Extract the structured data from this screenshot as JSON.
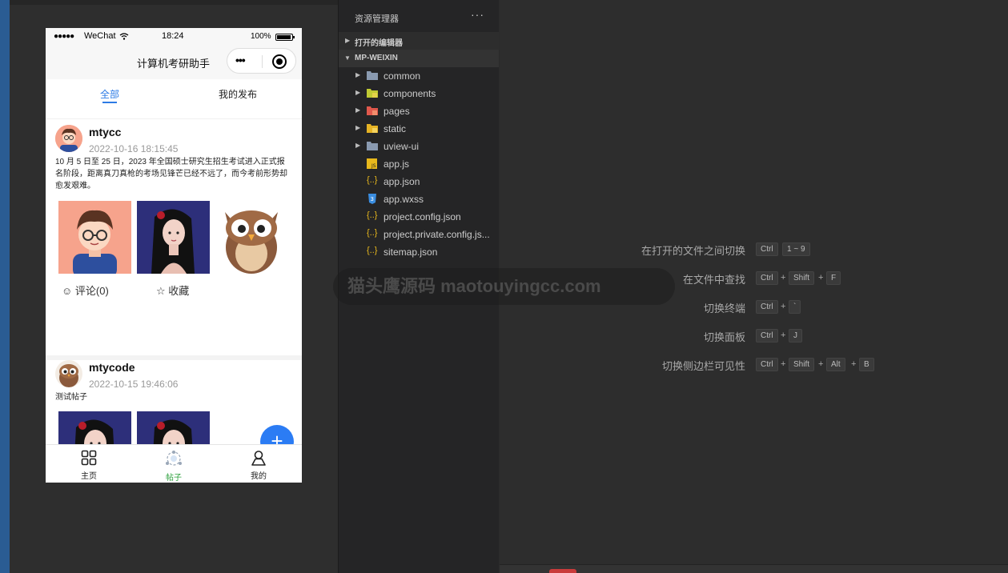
{
  "status_bar": {
    "signal": "●●●●●",
    "carrier": "WeChat",
    "time": "18:24",
    "battery": "100%"
  },
  "navbar": {
    "title": "计算机考研助手",
    "more": "•••"
  },
  "tabs": [
    {
      "label": "全部"
    },
    {
      "label": "我的发布"
    }
  ],
  "posts": [
    {
      "user": "mtycc",
      "date": "2022-10-16 18:15:45",
      "text": "10 月 5 日至 25 日，2023 年全国硕士研究生招生考试进入正式报名阶段，距离真刀真枪的考场见锋芒已经不远了，而今考前形势却愈发艰难。",
      "comments": "评论(0)",
      "favorite": "收藏"
    },
    {
      "user": "mtycode",
      "date": "2022-10-15 19:46:06",
      "text": "测试帖子"
    }
  ],
  "fab": "+",
  "tabbar": [
    {
      "label": "主页"
    },
    {
      "label": "帖子"
    },
    {
      "label": "我的"
    }
  ],
  "explorer": {
    "title": "资源管理器",
    "more": "···",
    "open_editors": "打开的编辑器",
    "root": "MP-WEIXIN",
    "items": [
      {
        "name": "common",
        "icon": "folder-icon"
      },
      {
        "name": "components",
        "icon": "folder-icon"
      },
      {
        "name": "pages",
        "icon": "folder-icon"
      },
      {
        "name": "static",
        "icon": "folder-icon"
      },
      {
        "name": "uview-ui",
        "icon": "folder-icon"
      },
      {
        "name": "app.js",
        "icon": "js-file-icon"
      },
      {
        "name": "app.json",
        "icon": "json-file-icon"
      },
      {
        "name": "app.wxss",
        "icon": "css-file-icon"
      },
      {
        "name": "project.config.json",
        "icon": "json-file-icon"
      },
      {
        "name": "project.private.config.js...",
        "icon": "json-file-icon"
      },
      {
        "name": "sitemap.json",
        "icon": "json-file-icon"
      }
    ]
  },
  "shortcuts": [
    {
      "label": "在打开的文件之间切换",
      "keys": [
        "Ctrl",
        "1 ~ 9"
      ]
    },
    {
      "label": "在文件中查找",
      "keys": [
        "Ctrl",
        "Shift",
        "F"
      ]
    },
    {
      "label": "切换终端",
      "keys": [
        "Ctrl",
        "`"
      ]
    },
    {
      "label": "切换面板",
      "keys": [
        "Ctrl",
        "J"
      ]
    },
    {
      "label": "切换侧边栏可见性",
      "keys": [
        "Ctrl",
        "Shift",
        "Alt",
        "B"
      ]
    }
  ],
  "watermark": "猫头鹰源码 maotouyingcc.com",
  "colors": {
    "accent": "#2d7be5",
    "fab": "#2b7cf4",
    "active_tab": "#2aa03a"
  }
}
